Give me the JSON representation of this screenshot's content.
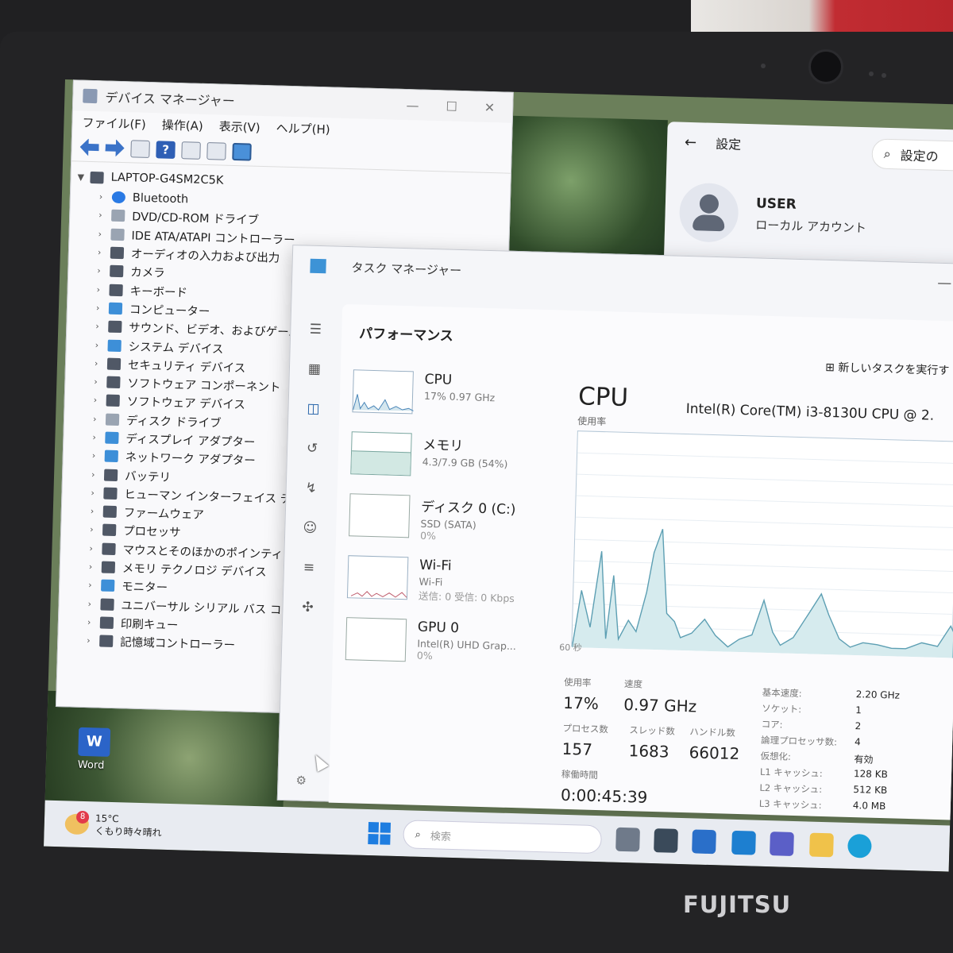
{
  "device_manager": {
    "title": "デバイス マネージャー",
    "menu": [
      "ファイル(F)",
      "操作(A)",
      "表示(V)",
      "ヘルプ(H)"
    ],
    "root": "LAPTOP-G4SM2C5K",
    "items": [
      "Bluetooth",
      "DVD/CD-ROM ドライブ",
      "IDE ATA/ATAPI コントローラー",
      "オーディオの入力および出力",
      "カメラ",
      "キーボード",
      "コンピューター",
      "サウンド、ビデオ、およびゲーム",
      "システム デバイス",
      "セキュリティ デバイス",
      "ソフトウェア コンポーネント",
      "ソフトウェア デバイス",
      "ディスク ドライブ",
      "ディスプレイ アダプター",
      "ネットワーク アダプター",
      "バッテリ",
      "ヒューマン インターフェイス デバ",
      "ファームウェア",
      "プロセッサ",
      "マウスとそのほかのポインティン",
      "メモリ テクノロジ デバイス",
      "モニター",
      "ユニバーサル シリアル バス コン",
      "印刷キュー",
      "記憶域コントローラー"
    ]
  },
  "settings": {
    "title": "設定",
    "search_placeholder": "設定の",
    "user_name": "USER",
    "user_type": "ローカル アカウント"
  },
  "task_manager": {
    "title": "タスク マネージャー",
    "heading": "パフォーマンス",
    "new_task": "新しいタスクを実行す",
    "tiles": [
      {
        "name": "CPU",
        "sub": "17%  0.97 GHz",
        "sub2": ""
      },
      {
        "name": "メモリ",
        "sub": "4.3/7.9 GB (54%)",
        "sub2": ""
      },
      {
        "name": "ディスク 0 (C:)",
        "sub": "SSD (SATA)",
        "sub2": "0%"
      },
      {
        "name": "Wi-Fi",
        "sub": "Wi-Fi",
        "sub2": "送信: 0 受信: 0 Kbps"
      },
      {
        "name": "GPU 0",
        "sub": "Intel(R) UHD Grap...",
        "sub2": "0%"
      }
    ],
    "detail": {
      "title": "CPU",
      "cpu_name": "Intel(R) Core(TM) i3-8130U CPU @ 2.",
      "usage_label": "使用率",
      "axis_left": "60 秒",
      "stats": {
        "usage_label": "使用率",
        "usage": "17%",
        "speed_label": "速度",
        "speed": "0.97 GHz",
        "processes_label": "プロセス数",
        "processes": "157",
        "threads_label": "スレッド数",
        "threads": "1683",
        "handles_label": "ハンドル数",
        "handles": "66012",
        "uptime_label": "稼働時間",
        "uptime": "0:00:45:39"
      },
      "specs": [
        {
          "key": "基本速度:",
          "value": "2.20 GHz"
        },
        {
          "key": "ソケット:",
          "value": "1"
        },
        {
          "key": "コア:",
          "value": "2"
        },
        {
          "key": "論理プロセッサ数:",
          "value": "4"
        },
        {
          "key": "仮想化:",
          "value": "有効"
        },
        {
          "key": "L1 キャッシュ:",
          "value": "128 KB"
        },
        {
          "key": "L2 キャッシュ:",
          "value": "512 KB"
        },
        {
          "key": "L3 キャッシュ:",
          "value": "4.0 MB"
        }
      ]
    }
  },
  "desktop": {
    "word_label": "Word",
    "word_letter": "W"
  },
  "taskbar": {
    "temp": "15°C",
    "weather": "くもり時々晴れ",
    "weather_badge": "8",
    "search_placeholder": "検索"
  },
  "brand": "FUJITSU"
}
